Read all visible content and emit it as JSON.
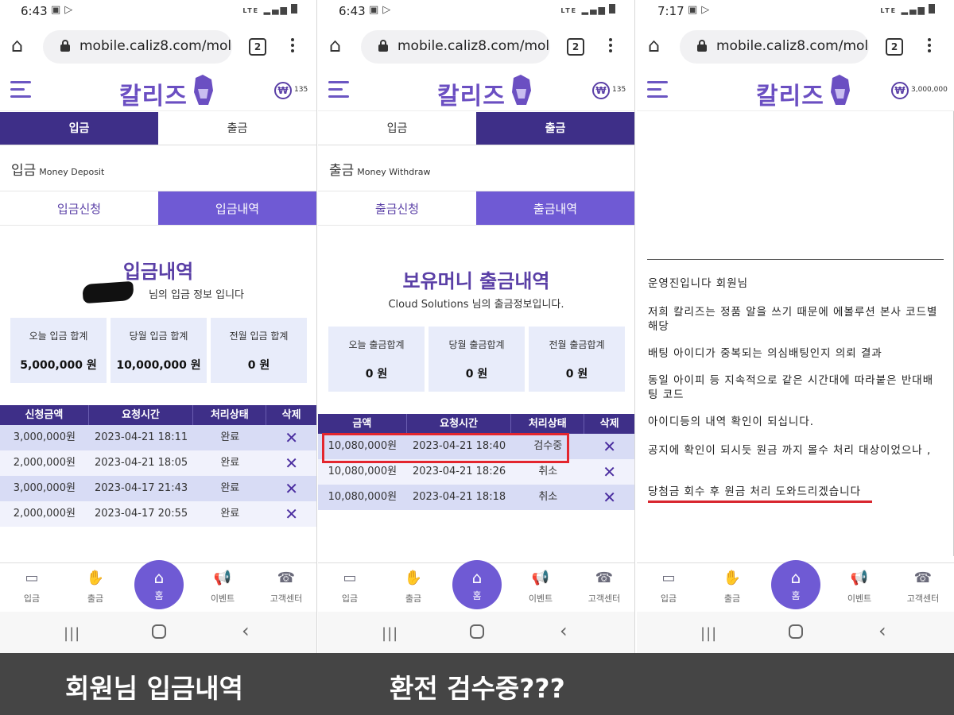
{
  "colors": {
    "accent": "#3e2f88",
    "accent_light": "#6f5ad4",
    "highlight_red": "#e3262e"
  },
  "panels": [
    {
      "status": {
        "time": "6:43",
        "net": "LTE"
      },
      "browser": {
        "url": "mobile.caliz8.com/mol",
        "tab_count": "2"
      },
      "site": {
        "logo": "칼리즈",
        "balance": "135"
      },
      "main_tabs": [
        "입금",
        "출금"
      ],
      "section": {
        "title": "입금",
        "subtitle": "Money Deposit"
      },
      "sub_tabs": [
        "입금신청",
        "입금내역"
      ],
      "history": {
        "title": "입금내역",
        "subtitle": "님의 입금 정보 입니다"
      },
      "stats": [
        {
          "label": "오늘 입금 합계",
          "value": "5,000,000 원"
        },
        {
          "label": "당월 입금 합계",
          "value": "10,000,000 원"
        },
        {
          "label": "전월 입금 합계",
          "value": "0 원"
        }
      ],
      "table": {
        "headers": [
          "신청금액",
          "요청시간",
          "처리상태",
          "삭제"
        ],
        "rows": [
          {
            "amount": "3,000,000원",
            "time": "2023-04-21 18:11",
            "status": "완료",
            "del": "✕"
          },
          {
            "amount": "2,000,000원",
            "time": "2023-04-21 18:05",
            "status": "완료",
            "del": "✕"
          },
          {
            "amount": "3,000,000원",
            "time": "2023-04-17 21:43",
            "status": "완료",
            "del": "✕"
          },
          {
            "amount": "2,000,000원",
            "time": "2023-04-17 20:55",
            "status": "완료",
            "del": "✕"
          }
        ]
      }
    },
    {
      "status": {
        "time": "6:43",
        "net": "LTE"
      },
      "browser": {
        "url": "mobile.caliz8.com/mol",
        "tab_count": "2"
      },
      "site": {
        "logo": "칼리즈",
        "balance": "135"
      },
      "main_tabs": [
        "입금",
        "출금"
      ],
      "section": {
        "title": "출금",
        "subtitle": "Money Withdraw"
      },
      "sub_tabs": [
        "출금신청",
        "출금내역"
      ],
      "history": {
        "title": "보유머니 출금내역",
        "subtitle": "Cloud Solutions 님의 출금정보입니다."
      },
      "stats": [
        {
          "label": "오늘 출금합계",
          "value": "0 원"
        },
        {
          "label": "당월 출금합계",
          "value": "0 원"
        },
        {
          "label": "전월 출금합계",
          "value": "0 원"
        }
      ],
      "table": {
        "headers": [
          "금액",
          "요청시간",
          "처리상태",
          "삭제"
        ],
        "rows": [
          {
            "amount": "10,080,000원",
            "time": "2023-04-21 18:40",
            "status": "검수중",
            "del": "✕"
          },
          {
            "amount": "10,080,000원",
            "time": "2023-04-21 18:26",
            "status": "취소",
            "del": "✕"
          },
          {
            "amount": "10,080,000원",
            "time": "2023-04-21 18:18",
            "status": "취소",
            "del": "✕"
          }
        ]
      }
    },
    {
      "status": {
        "time": "7:17",
        "net": "LTE"
      },
      "browser": {
        "url": "mobile.caliz8.com/mol",
        "tab_count": "2"
      },
      "site": {
        "logo": "칼리즈",
        "balance": "3,000,000"
      },
      "notice": [
        "운영진입니다 회원님",
        "저희 칼리즈는 정품 알을 쓰기 때문에 에볼루션 본사 코드별 해당",
        "배팅 아이디가 중복되는 의심배팅인지 의뢰 결과",
        "동일 아이피 등 지속적으로 같은 시간대에 따라붙은 반대배팅 코드",
        "아이디등의 내역 확인이 되십니다.",
        "공지에 확인이 되시듯 원금 까지 몰수 처리 대상이었으나 ,",
        "당첨금 회수 후 원금 처리 도와드리겠습니다"
      ]
    }
  ],
  "bottom_nav": {
    "deposit": "입금",
    "withdraw": "출금",
    "home": "홈",
    "event": "이벤트",
    "support": "고객센터"
  },
  "captions": {
    "left": "회원님 입금내역",
    "right": "환전 검수중???"
  }
}
